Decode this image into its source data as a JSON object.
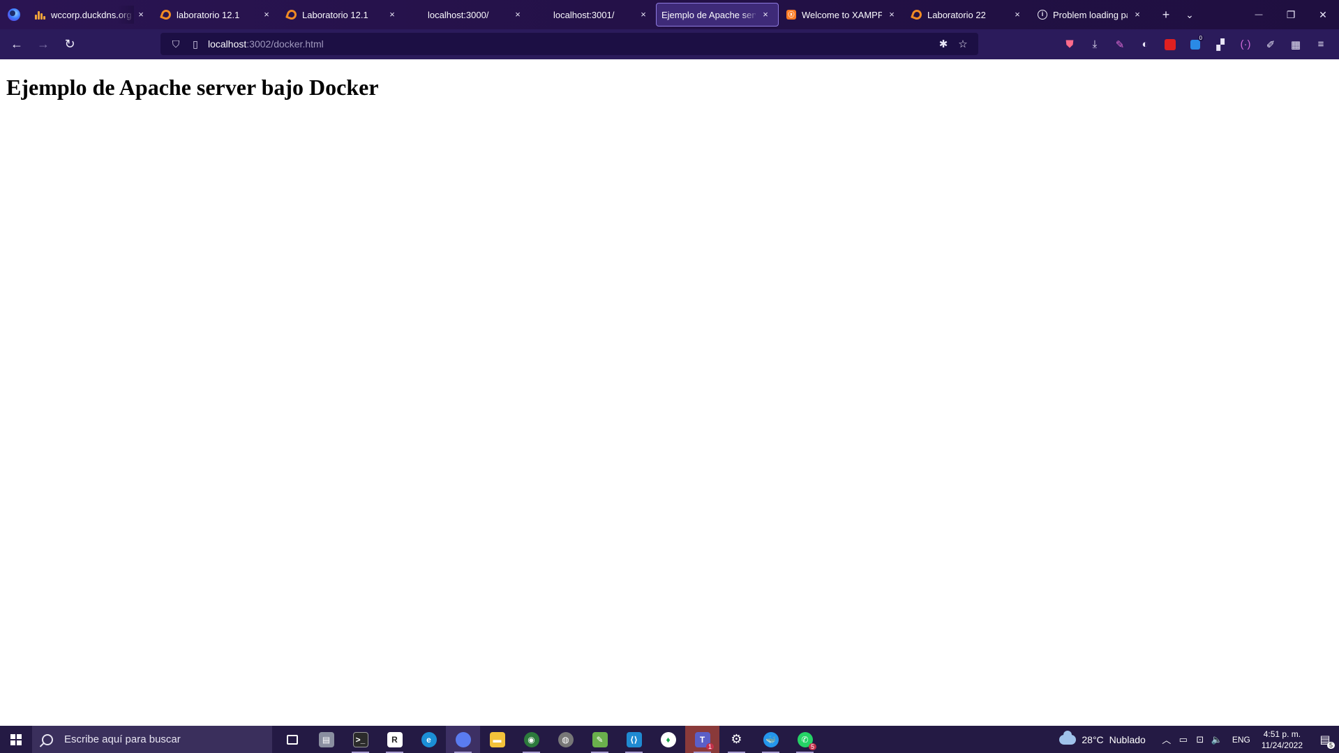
{
  "browser": {
    "tabs": [
      {
        "title": "wccorp.duckdns.org / l",
        "favicon": "phpmyadmin-icon",
        "active": false
      },
      {
        "title": "laboratorio 12.1",
        "favicon": "orange-logo-icon",
        "active": false
      },
      {
        "title": "Laboratorio 12.1",
        "favicon": "orange-logo-icon",
        "active": false
      },
      {
        "title": "localhost:3000/",
        "favicon": "",
        "active": false
      },
      {
        "title": "localhost:3001/",
        "favicon": "",
        "active": false
      },
      {
        "title": "Ejemplo de Apache server b",
        "favicon": "",
        "active": true
      },
      {
        "title": "Welcome to XAMPP",
        "favicon": "xampp-icon",
        "active": false
      },
      {
        "title": "Laboratorio 22",
        "favicon": "orange-logo-icon",
        "active": false
      },
      {
        "title": "Problem loading page",
        "favicon": "info-icon",
        "active": false
      }
    ],
    "tab_close_glyph": "×",
    "new_tab_glyph": "+",
    "list_tabs_glyph": "⌄",
    "window": {
      "minimize": "—",
      "restore": "❐",
      "close": "✕"
    },
    "nav": {
      "back": "←",
      "forward": "→",
      "reload": "↻"
    },
    "url": {
      "host": "localhost",
      "rest": ":3002/docker.html"
    },
    "toolbar_badge": "0"
  },
  "page": {
    "heading": "Ejemplo de Apache server bajo Docker"
  },
  "taskbar": {
    "search_placeholder": "Escribe aquí para buscar",
    "weather_temp": "28°C",
    "weather_desc": "Nublado",
    "language": "ENG",
    "time": "4:51 p. m.",
    "date": "11/24/2022",
    "teams_count": "1",
    "whatsapp_count": "5",
    "notification_count": "5"
  },
  "colors": {
    "tabbar_bg": "#221045",
    "navbar_bg": "#2b1b5b",
    "urlbar_bg": "#1c0f44",
    "taskbar_bg": "#241a44"
  }
}
